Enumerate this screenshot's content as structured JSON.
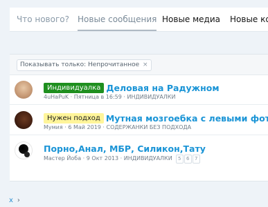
{
  "tabs": [
    {
      "label": "Что нового?"
    },
    {
      "label": "Новые сообщения",
      "active": true
    },
    {
      "label": "Новые медиа"
    },
    {
      "label": "Новые ком"
    }
  ],
  "filter": {
    "label": "Показывать только: Непрочитанное",
    "close": "×"
  },
  "threads": [
    {
      "prefix": "Индивидуалка",
      "prefix_color": "#1f8f1f",
      "title": "Деловая на Радужном",
      "author": "4uHaPuK",
      "date": "Пятница в 16:59",
      "forum": "ИНДИВИДУАЛКИ",
      "pages": []
    },
    {
      "prefix": "Нужен подход",
      "prefix_color": "#fff59a",
      "title": "Мутная мозгоебка с левыми фото",
      "author": "Мумия",
      "date": "6 Май 2019",
      "forum": "СОДЕРЖАНКИ БЕЗ ПОДХОДА",
      "pages": []
    },
    {
      "prefix": "",
      "title": "Порно,Анал, МБР, Силикон,Тату",
      "author": "Мастер Йоба",
      "date": "9 Окт 2013",
      "forum": "ИНДИВИДУАЛКИ",
      "pages": [
        "5",
        "6",
        "7"
      ]
    }
  ],
  "bottom_nav": {
    "close": "x",
    "chevron": "›"
  },
  "colors": {
    "link": "#1a94d6",
    "background": "#eef3f8"
  }
}
